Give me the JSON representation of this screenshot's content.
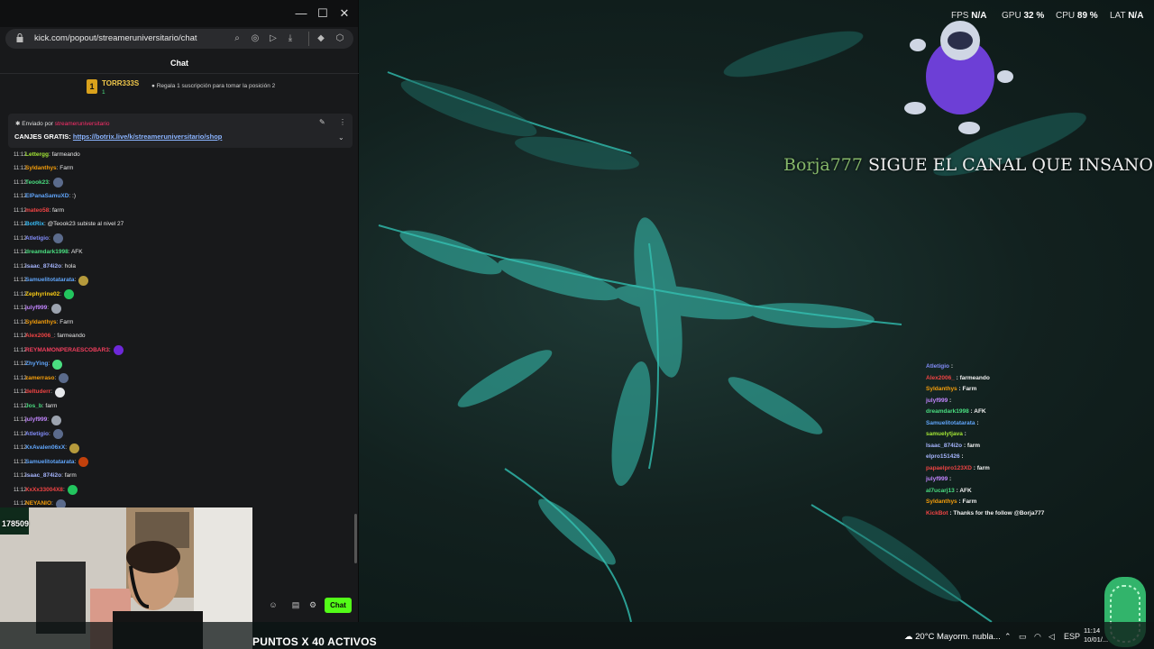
{
  "window": {
    "minimize": "—",
    "maximize": "☐",
    "close": "✕"
  },
  "browser": {
    "url": "kick.com/popout/streameruniversitario/chat"
  },
  "chat": {
    "header": "Chat",
    "leaderboard": {
      "rank": "1",
      "name": "TORR333S",
      "count": "1",
      "gift_prompt": "Regala 1 suscripción para tomar la posición 2"
    },
    "pinned": {
      "by_label": "Enviado por",
      "sender": "streameruniversitario",
      "prefix": "CANJES GRATIS:",
      "link": "https://botrix.live/k/streameruniversitario/shop"
    },
    "messages": [
      {
        "time": "11:12",
        "user": "Lettergg",
        "color": "#a3e635",
        "text": ": farmeando"
      },
      {
        "time": "11:12",
        "user": "Syldanthys",
        "color": "#f59e0b",
        "text": ": Farm"
      },
      {
        "time": "11:12",
        "user": "Teook23",
        "color": "#4ade80",
        "text": ":",
        "emote": "#5b6b8c"
      },
      {
        "time": "11:12",
        "user": "ElPanaSamuXD",
        "color": "#60a5fa",
        "text": ": :)"
      },
      {
        "time": "11:12",
        "user": "mateo58",
        "color": "#ef4444",
        "text": ": farm"
      },
      {
        "time": "11:12",
        "user": "BotRix",
        "color": "#38bdf8",
        "text": ": @Teook23 subiste al nivel 27"
      },
      {
        "time": "11:12",
        "user": "Atletigio",
        "color": "#818cf8",
        "text": ":",
        "emote": "#5b6b8c"
      },
      {
        "time": "11:12",
        "user": "dreamdark1998",
        "color": "#4ade80",
        "text": ": AFK"
      },
      {
        "time": "11:12",
        "user": "isaac_874i2o",
        "color": "#a5b4fc",
        "text": ": hola"
      },
      {
        "time": "11:12",
        "user": "Samuelitotatarata",
        "color": "#60a5fa",
        "text": ":",
        "emote": "#b59a3c"
      },
      {
        "time": "11:12",
        "user": "Zephyrine02",
        "color": "#facc15",
        "text": ":",
        "emote": "#22c55e"
      },
      {
        "time": "11:12",
        "user": "julyf999",
        "color": "#c084fc",
        "text": ":",
        "emote": "#9ca3af"
      },
      {
        "time": "11:12",
        "user": "Syldanthys",
        "color": "#f59e0b",
        "text": ": Farm"
      },
      {
        "time": "11:12",
        "user": "Alex2006_",
        "color": "#ef4444",
        "text": ": farmeando"
      },
      {
        "time": "11:12",
        "user": "REYMAMONPERAESCOBAR3",
        "color": "#f43f5e",
        "text": ":",
        "emote": "#6d28d9"
      },
      {
        "time": "11:12",
        "user": "ZhyYing",
        "color": "#60a5fa",
        "text": ":",
        "emote": "#4ade80"
      },
      {
        "time": "11:12",
        "user": "zamerraso",
        "color": "#f59e0b",
        "text": ":",
        "emote": "#5b6b8c"
      },
      {
        "time": "11:12",
        "user": "deltuderr",
        "color": "#ef4444",
        "text": ":",
        "emote": "#e5e7eb"
      },
      {
        "time": "11:12",
        "user": "Jos_b",
        "color": "#4ade80",
        "text": ": farm"
      },
      {
        "time": "11:12",
        "user": "julyf999",
        "color": "#c084fc",
        "text": ":",
        "emote": "#9ca3af"
      },
      {
        "time": "11:12",
        "user": "Atletigio",
        "color": "#818cf8",
        "text": ":",
        "emote": "#5b6b8c"
      },
      {
        "time": "11:12",
        "user": "XxAvalen06xX",
        "color": "#60a5fa",
        "text": ":",
        "emote": "#b59a3c"
      },
      {
        "time": "11:12",
        "user": "Samuelitotatarata",
        "color": "#60a5fa",
        "text": ":",
        "emote": "#c2410c"
      },
      {
        "time": "11:12",
        "user": "isaac_874i2o",
        "color": "#a5b4fc",
        "text": ": farm"
      },
      {
        "time": "11:12",
        "user": "XxXx33004X8",
        "color": "#ef4444",
        "text": ":",
        "emote": "#22c55e"
      },
      {
        "time": "11:12",
        "user": "NEYANIO",
        "color": "#f59e0b",
        "text": ":",
        "emote": "#5b6b8c"
      }
    ],
    "send_label": "Chat"
  },
  "webcam": {
    "label": "178509"
  },
  "hud": {
    "fps_label": "FPS",
    "fps_value": "N/A",
    "gpu_label": "GPU",
    "gpu_value": "32 %",
    "cpu_label": "CPU",
    "cpu_value": "89 %",
    "lat_label": "LAT",
    "lat_value": "N/A"
  },
  "alert": {
    "user": "Borja777",
    "text": "SIGUE EL CANAL QUE INSANO"
  },
  "overlay_chat": [
    {
      "user": "Atletigio",
      "color": "#818cf8",
      "text": ":"
    },
    {
      "user": "Alex2006_",
      "color": "#ef4444",
      "text": ": farmeando"
    },
    {
      "user": "Syldanthys",
      "color": "#f59e0b",
      "text": ": Farm"
    },
    {
      "user": "julyf999",
      "color": "#c084fc",
      "text": ":"
    },
    {
      "user": "dreamdark1998",
      "color": "#4ade80",
      "text": ": AFK"
    },
    {
      "user": "Samuelitotatarata",
      "color": "#60a5fa",
      "text": ":"
    },
    {
      "user": "samuelytjava",
      "color": "#a3e635",
      "text": ":"
    },
    {
      "user": "Isaac_874i2o",
      "color": "#a5b4fc",
      "text": ": farm"
    },
    {
      "user": "elpro151426",
      "color": "#a5b4fc",
      "text": ":"
    },
    {
      "user": "papaelpro123XD",
      "color": "#ef4444",
      "text": ": farm"
    },
    {
      "user": "julyf999",
      "color": "#c084fc",
      "text": ":"
    },
    {
      "user": "al7ucarj13",
      "color": "#4ade80",
      "text": ": AFK"
    },
    {
      "user": "Syldanthys",
      "color": "#f59e0b",
      "text": ": Farm"
    },
    {
      "user": "KickBot",
      "color": "#ef4444",
      "text": ": Thanks for the follow @Borja777"
    }
  ],
  "taskbar": {
    "puntos": "PUNTOS X 40 ACTIVOS",
    "weather": "20°C  Mayorm. nubla...",
    "lang": "ESP",
    "time": "11:14",
    "date": "10/01/..."
  }
}
